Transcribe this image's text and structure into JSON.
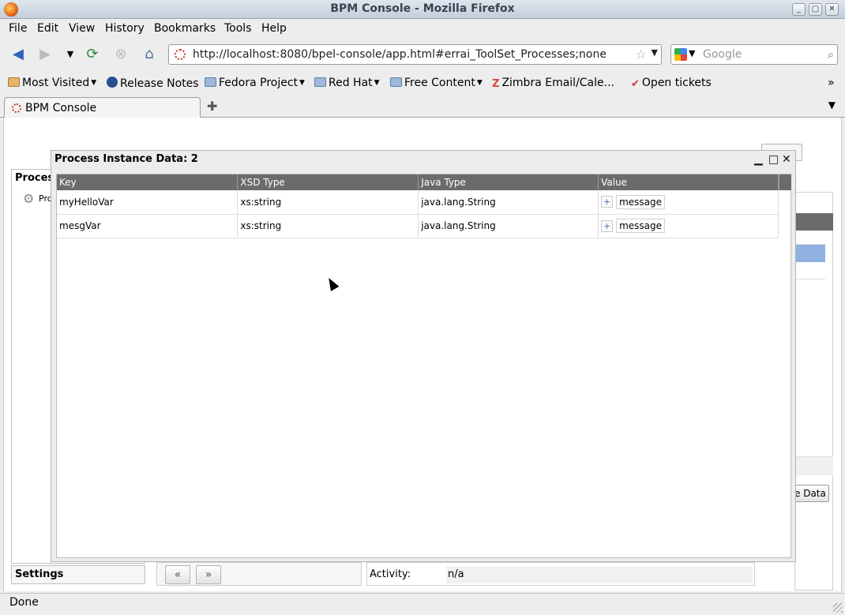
{
  "window": {
    "title": "BPM Console - Mozilla Firefox"
  },
  "menu": [
    "File",
    "Edit",
    "View",
    "History",
    "Bookmarks",
    "Tools",
    "Help"
  ],
  "nav": {
    "url": "http://localhost:8080/bpel-console/app.html#errai_ToolSet_Processes;none",
    "search_placeholder": "Google"
  },
  "bookmarks": [
    "Most Visited",
    "Release Notes",
    "Fedora Project",
    "Red Hat",
    "Free Content",
    "Zimbra Email/Cale...",
    "Open tickets"
  ],
  "tab": {
    "label": "BPM Console"
  },
  "left_panel": {
    "header": "Process",
    "item": "Pro",
    "settings": "Settings"
  },
  "pager": {
    "first": "«",
    "next": "»"
  },
  "activity": {
    "label": "Activity:",
    "value": "n/a"
  },
  "background": {
    "data_button": "e Data"
  },
  "dialog": {
    "title": "Process Instance Data: 2",
    "columns": [
      "Key",
      "XSD Type",
      "Java Type",
      "Value"
    ],
    "rows": [
      {
        "key": "myHelloVar",
        "xsd": "xs:string",
        "java": "java.lang.String",
        "value": "message"
      },
      {
        "key": "mesgVar",
        "xsd": "xs:string",
        "java": "java.lang.String",
        "value": "message"
      }
    ]
  },
  "status": {
    "text": "Done"
  }
}
